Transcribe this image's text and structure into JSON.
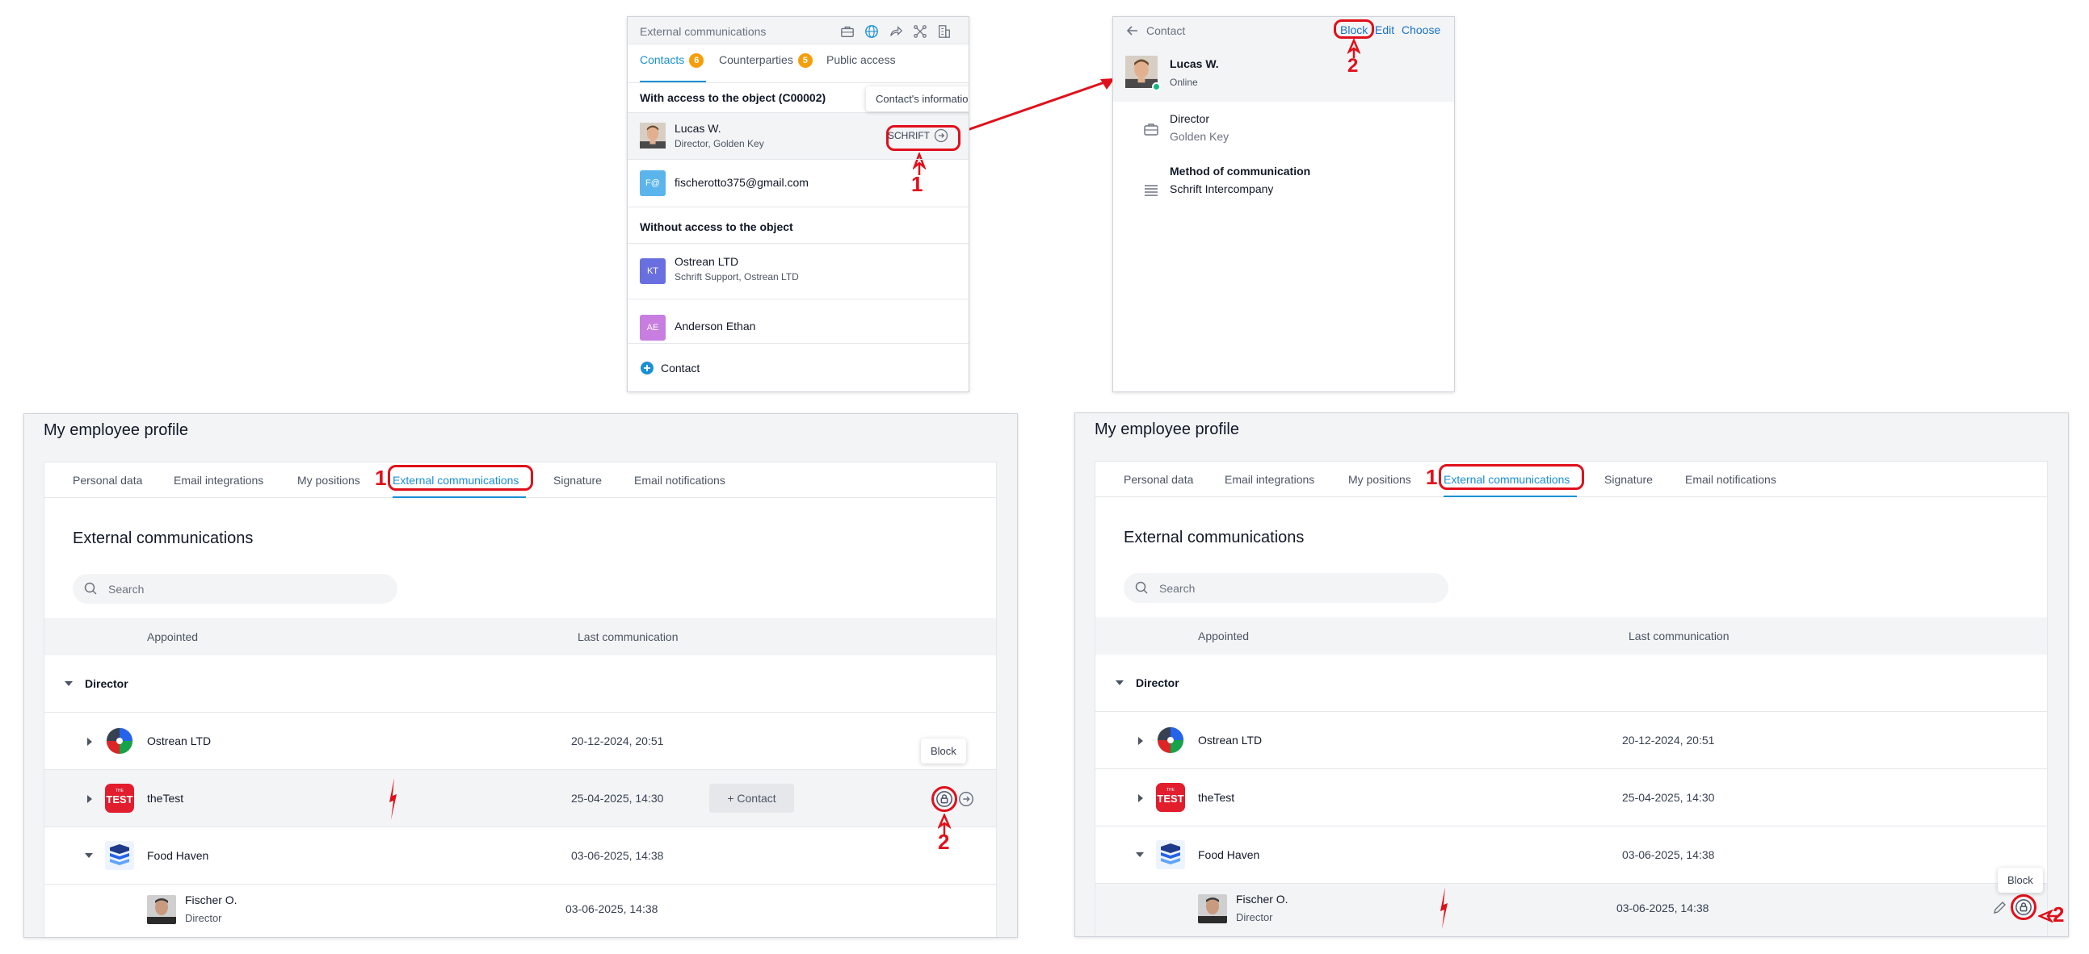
{
  "colors": {
    "accent": "#1a90d4",
    "link": "#1a73c8",
    "annotation": "#e0101b",
    "badge": "#f59e0b",
    "online": "#10b981"
  },
  "panel_contacts": {
    "title": "External communications",
    "header_icons": [
      "briefcase-icon",
      "globe-icon",
      "share-icon",
      "network-icon",
      "building-icon"
    ],
    "tabs": [
      {
        "label": "Contacts",
        "count": "6"
      },
      {
        "label": "Counterparties",
        "count": "5"
      },
      {
        "label": "Public access"
      }
    ],
    "section_with_access": "With access to the object (C00002)",
    "tooltip": "Contact's information",
    "contacts_with_access": [
      {
        "name": "Lucas W.",
        "subtitle": "Director, Golden Key",
        "badge_text": "SCHRIFT"
      },
      {
        "name": "fischerotto375@gmail.com",
        "initials": "F@",
        "color": "#5bb5ec"
      }
    ],
    "section_without_access": "Without access to the object",
    "contacts_without_access": [
      {
        "name": "Ostrean LTD",
        "subtitle": "Schrift Support, Ostrean LTD",
        "initials": "KT",
        "color": "#6a6fe0"
      },
      {
        "name": "Anderson Ethan",
        "initials": "AE",
        "color": "#c77ee0"
      }
    ],
    "add_contact": "Contact",
    "annotation": "1"
  },
  "panel_contact_info": {
    "back_label": "Contact",
    "actions": {
      "block": "Block",
      "edit": "Edit",
      "choose": "Choose"
    },
    "name": "Lucas W.",
    "status": "Online",
    "position": "Director",
    "company": "Golden Key",
    "method_title": "Method of communication",
    "method_value": "Schrift Intercompany",
    "annotation": "2"
  },
  "profile_left": {
    "title": "My employee profile",
    "tabs": [
      "Personal data",
      "Email integrations",
      "My positions",
      "External communications",
      "Signature",
      "Email notifications"
    ],
    "heading": "External communications",
    "search_placeholder": "Search",
    "columns": {
      "appointed": "Appointed",
      "last": "Last communication"
    },
    "group": "Director",
    "rows": [
      {
        "name": "Ostrean LTD",
        "date": "20-12-2024, 20:51"
      },
      {
        "name": "theTest",
        "date": "25-04-2025, 14:30",
        "contact_button": "+ Contact"
      },
      {
        "name": "Food Haven",
        "date": "03-06-2025, 14:38"
      },
      {
        "name": "Fischer O.",
        "subtitle": "Director",
        "date": "03-06-2025, 14:38"
      }
    ],
    "tooltip": "Block",
    "annotation_tab": "1",
    "annotation_action": "2"
  },
  "profile_right": {
    "title": "My employee profile",
    "tabs": [
      "Personal data",
      "Email integrations",
      "My positions",
      "External communications",
      "Signature",
      "Email notifications"
    ],
    "heading": "External communications",
    "search_placeholder": "Search",
    "columns": {
      "appointed": "Appointed",
      "last": "Last communication"
    },
    "group": "Director",
    "rows": [
      {
        "name": "Ostrean LTD",
        "date": "20-12-2024, 20:51"
      },
      {
        "name": "theTest",
        "date": "25-04-2025, 14:30"
      },
      {
        "name": "Food Haven",
        "date": "03-06-2025, 14:38"
      },
      {
        "name": "Fischer O.",
        "subtitle": "Director",
        "date": "03-06-2025, 14:38"
      }
    ],
    "tooltip": "Block",
    "annotation_tab": "1",
    "annotation_action": "2"
  }
}
